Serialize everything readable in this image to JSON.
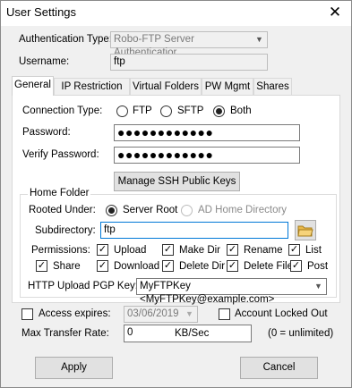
{
  "window": {
    "title": "User Settings",
    "close_glyph": "✕"
  },
  "auth": {
    "label": "Authentication Type:",
    "value": "Robo-FTP Server Authenticatior"
  },
  "username": {
    "label": "Username:",
    "value": "ftp"
  },
  "tabs": [
    "General",
    "IP Restriction",
    "Virtual Folders",
    "PW Mgmt",
    "Shares"
  ],
  "connection": {
    "label": "Connection Type:",
    "options": [
      "FTP",
      "SFTP",
      "Both"
    ],
    "selected": "Both"
  },
  "password": {
    "label": "Password:",
    "value": "●●●●●●●●●●●●"
  },
  "verify_password": {
    "label": "Verify Password:",
    "value": "●●●●●●●●●●●●"
  },
  "ssh_button": "Manage SSH Public Keys",
  "home_folder": {
    "group_label": "Home Folder",
    "rooted_label": "Rooted Under:",
    "rooted_options": [
      "Server Root",
      "AD Home Directory"
    ],
    "rooted_selected": "Server Root",
    "subdir_label": "Subdirectory:",
    "subdir_value": "ftp"
  },
  "permissions": {
    "label": "Permissions:",
    "row1": [
      "Upload",
      "Make Dir",
      "Rename",
      "List"
    ],
    "row2": [
      "Share",
      "Download",
      "Delete Dir",
      "Delete File",
      "Post"
    ],
    "check_glyph": "✓"
  },
  "pgp": {
    "label": "HTTP Upload PGP Key:",
    "value": "MyFTPKey <MyFTPKey@example.com>"
  },
  "access_expires": {
    "label": "Access expires:",
    "date": "03/06/2019",
    "checked": false
  },
  "account_locked": {
    "label": "Account Locked Out",
    "checked": false
  },
  "transfer_rate": {
    "label": "Max Transfer Rate:",
    "value": "0",
    "unit": "KB/Sec",
    "hint": "(0 = unlimited)"
  },
  "buttons": {
    "apply": "Apply",
    "cancel": "Cancel"
  },
  "icons": {
    "folder": "folder-open-icon",
    "dropdown": "chevron-down-icon"
  }
}
